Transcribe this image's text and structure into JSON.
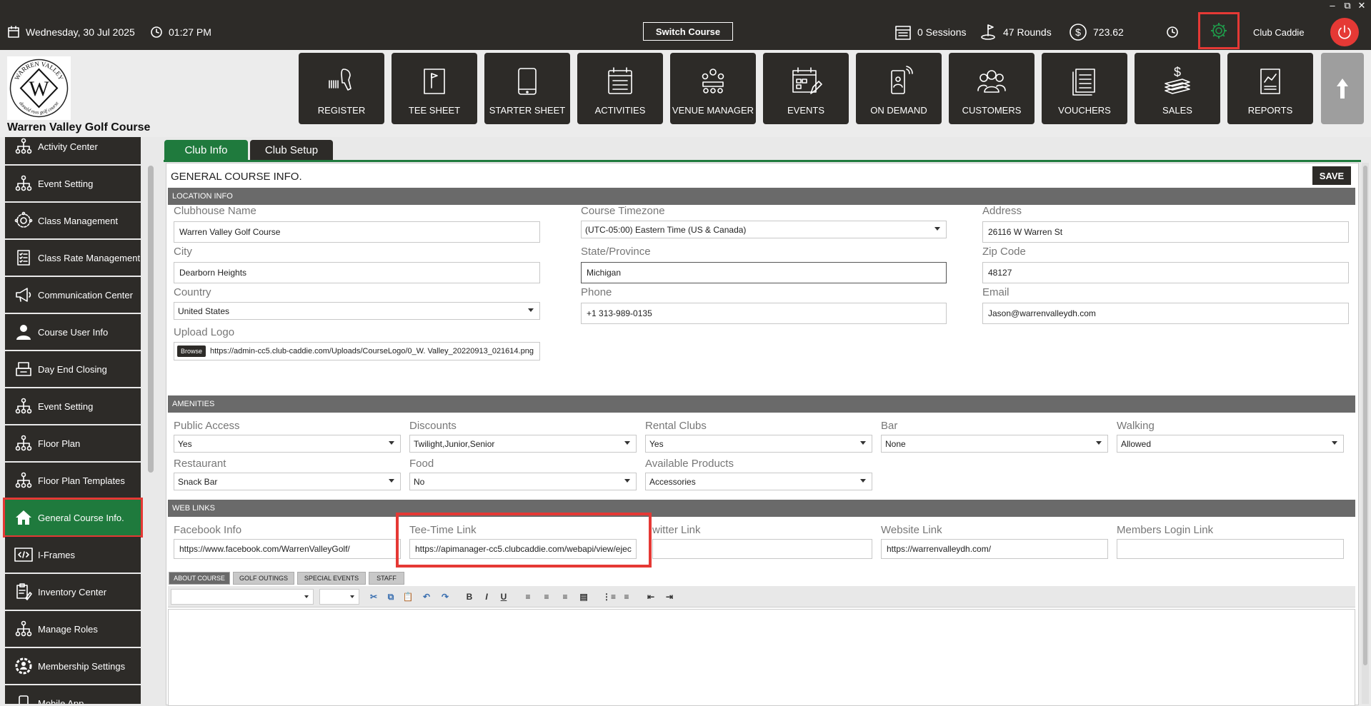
{
  "topbar": {
    "date": "Wednesday,  30 Jul 2025",
    "time": "01:27 PM",
    "switch_course": "Switch Course",
    "sessions": "0 Sessions",
    "rounds": "47 Rounds",
    "amount": "723.62",
    "user": "Club Caddie"
  },
  "header": {
    "course_name": "Warren Valley Golf Course",
    "logo_top_text": "WARREN VALLEY",
    "logo_bottom_text": "donald ross golf course",
    "logo_letter": "W",
    "nav": [
      {
        "label": "REGISTER",
        "icon": "scanner-icon"
      },
      {
        "label": "TEE SHEET",
        "icon": "flag-icon"
      },
      {
        "label": "STARTER SHEET",
        "icon": "tablet-icon"
      },
      {
        "label": "ACTIVITIES",
        "icon": "calendar-list-icon"
      },
      {
        "label": "VENUE MANAGER",
        "icon": "meeting-icon"
      },
      {
        "label": "EVENTS",
        "icon": "calendar-edit-icon"
      },
      {
        "label": "ON DEMAND",
        "icon": "phone-person-icon"
      },
      {
        "label": "CUSTOMERS",
        "icon": "users-icon"
      },
      {
        "label": "VOUCHERS",
        "icon": "voucher-icon"
      },
      {
        "label": "SALES",
        "icon": "cash-icon"
      },
      {
        "label": "REPORTS",
        "icon": "report-icon"
      }
    ]
  },
  "sidebar": {
    "items": [
      {
        "label": "Activity  Center"
      },
      {
        "label": "Event Setting"
      },
      {
        "label": "Class Management"
      },
      {
        "label": "Class Rate Management"
      },
      {
        "label": "Communication Center"
      },
      {
        "label": "Course User Info"
      },
      {
        "label": "Day End Closing"
      },
      {
        "label": "Event Setting"
      },
      {
        "label": "Floor Plan"
      },
      {
        "label": "Floor Plan Templates"
      },
      {
        "label": "General Course Info."
      },
      {
        "label": "I-Frames"
      },
      {
        "label": "Inventory Center"
      },
      {
        "label": "Manage Roles"
      },
      {
        "label": "Membership Settings"
      },
      {
        "label": "Mobile App"
      }
    ]
  },
  "tabs": {
    "club_info": "Club Info",
    "club_setup": "Club Setup"
  },
  "panel": {
    "title": "GENERAL COURSE INFO.",
    "save": "SAVE",
    "location": {
      "header": "LOCATION INFO",
      "clubhouse_label": "Clubhouse Name",
      "clubhouse": "Warren Valley Golf Course",
      "timezone_label": "Course Timezone",
      "timezone": "(UTC-05:00) Eastern Time (US & Canada)",
      "address_label": "Address",
      "address": "26116 W Warren St",
      "city_label": "City",
      "city": "Dearborn Heights",
      "state_label": "State/Province",
      "state": "Michigan",
      "zip_label": "Zip Code",
      "zip": "48127",
      "country_label": "Country",
      "country": "United States",
      "phone_label": "Phone",
      "phone": "+1 313-989-0135",
      "email_label": "Email",
      "email": "Jason@warrenvalleydh.com",
      "logo_label": "Upload Logo",
      "browse": "Browse",
      "logo_url": "https://admin-cc5.club-caddie.com/Uploads/CourseLogo/0_W. Valley_20220913_021614.png"
    },
    "amenities": {
      "header": "AMENITIES",
      "public_access_label": "Public Access",
      "public_access": "Yes",
      "discounts_label": "Discounts",
      "discounts": "Twilight,Junior,Senior",
      "rental_clubs_label": "Rental Clubs",
      "rental_clubs": "Yes",
      "bar_label": "Bar",
      "bar": "None",
      "walking_label": "Walking",
      "walking": "Allowed",
      "restaurant_label": "Restaurant",
      "restaurant": "Snack Bar",
      "food_label": "Food",
      "food": "No",
      "products_label": "Available Products",
      "products": "Accessories"
    },
    "weblinks": {
      "header": "WEB LINKS",
      "facebook_label": "Facebook Info",
      "facebook": "https://www.facebook.com/WarrenValleyGolf/",
      "teetime_label": "Tee-Time Link",
      "teetime": "https://apimanager-cc5.clubcaddie.com/webapi/view/ejec",
      "twitter_label": "witter Link",
      "twitter": "",
      "website_label": "Website Link",
      "website": "https://warrenvalleydh.com/",
      "members_label": "Members Login Link",
      "members": ""
    },
    "bottom_tabs": [
      "ABOUT COURSE",
      "GOLF OUTINGS",
      "SPECIAL EVENTS",
      "STAFF"
    ]
  },
  "colors": {
    "dark": "#2d2b28",
    "accent": "#1f7a3d",
    "highlight": "#e53935"
  }
}
